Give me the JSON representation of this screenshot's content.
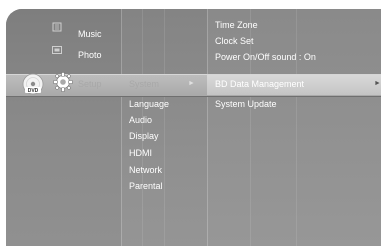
{
  "left_menu": {
    "items": [
      {
        "label": "Music",
        "icon": "music-icon"
      },
      {
        "label": "Photo",
        "icon": "photo-icon"
      },
      {
        "label": "Setup",
        "icon": "gear-icon",
        "selected": true
      }
    ],
    "disc_icon": {
      "label": "DVD",
      "icon": "dvd-disc-icon"
    }
  },
  "middle_menu": {
    "selected": "System",
    "items": [
      "Language",
      "Audio",
      "Display",
      "HDMI",
      "Network",
      "Parental"
    ]
  },
  "right_menu": {
    "top_items": [
      "Time Zone",
      "Clock Set",
      "Power On/Off sound :  On"
    ],
    "selected": "BD Data Management",
    "items": [
      "System Update"
    ]
  },
  "colors": {
    "selection_band": "#bdbdbd",
    "text": "#ffffff",
    "selected_text": "#ffffff"
  }
}
